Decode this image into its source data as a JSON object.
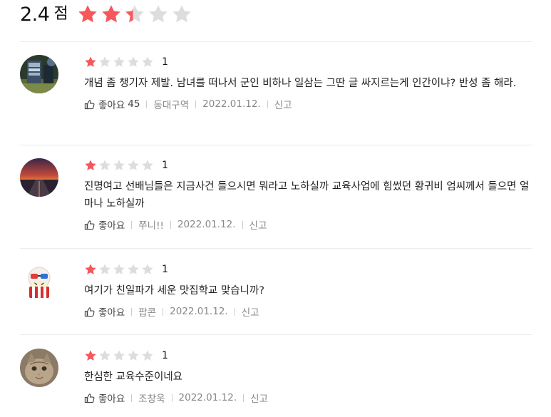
{
  "summary": {
    "score": "2.4",
    "unit": "점",
    "rating": 2.4,
    "max": 5
  },
  "colors": {
    "star_on": "#f6575b",
    "star_off": "#dddddd"
  },
  "like_label": "좋아요",
  "report_label": "신고",
  "reviews": [
    {
      "stars": 1,
      "rating": "1",
      "text": "개념 좀 챙기자 제발. 남녀를 떠나서 군인 비하나 일삼는 그딴 글 싸지르는게 인간이냐? 반성 좀 해라.",
      "likes": "45",
      "author": "동대구역",
      "date": "2022.01.12.",
      "avatar": "sign-photo"
    },
    {
      "stars": 1,
      "rating": "1",
      "text": "진명여고 선배님들은 지금사건 들으시면 뭐라고 노하실까 교육사업에 힘썼던 황귀비 엄씨께서 들으면 얼마나 노하실까",
      "likes": "",
      "author": "쭈니!!",
      "date": "2022.01.12.",
      "avatar": "sunset-road"
    },
    {
      "stars": 1,
      "rating": "1",
      "text": "여기가 친일파가 세운 맛집학교 맞습니까?",
      "likes": "",
      "author": "팝콘",
      "date": "2022.01.12.",
      "avatar": "popcorn-3d"
    },
    {
      "stars": 1,
      "rating": "1",
      "text": "한심한 교육수준이네요",
      "likes": "",
      "author": "조창욱",
      "date": "2022.01.12.",
      "avatar": "cat-photo"
    }
  ]
}
